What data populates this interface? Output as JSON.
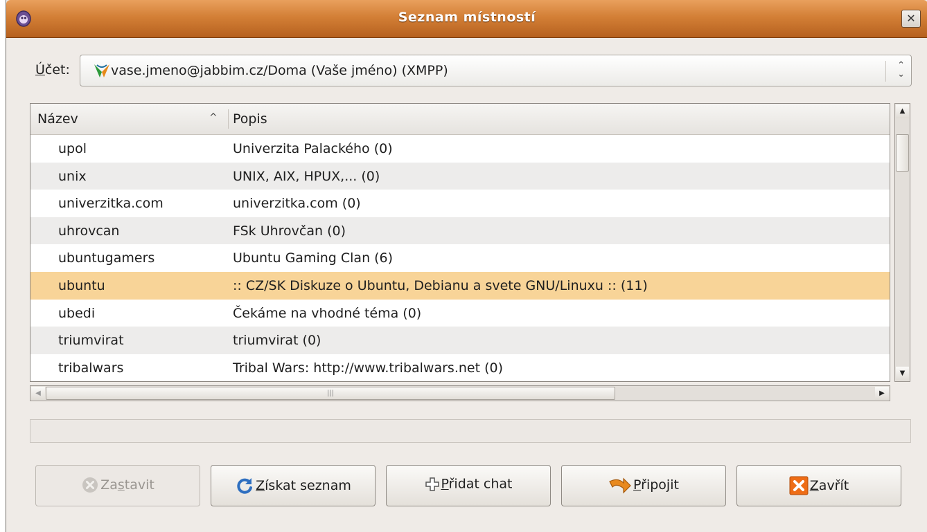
{
  "window": {
    "title": "Seznam místností",
    "close_glyph": "✕"
  },
  "account": {
    "label_accel": "Ú",
    "label_rest": "čet:",
    "value": "vase.jmeno@jabbim.cz/Doma (Vaše jméno) (XMPP)",
    "icon": "xmpp-icon"
  },
  "list": {
    "headers": {
      "name": "Název",
      "description": "Popis",
      "sort_indicator": "^"
    },
    "rows": [
      {
        "name": "upol",
        "description": "Univerzita Palackého (0)"
      },
      {
        "name": "unix",
        "description": "UNIX, AIX, HPUX,... (0)"
      },
      {
        "name": "univerzitka.com",
        "description": "univerzitka.com (0)"
      },
      {
        "name": "uhrovcan",
        "description": "FSk Uhrovčan (0)"
      },
      {
        "name": "ubuntugamers",
        "description": "Ubuntu Gaming Clan (6)"
      },
      {
        "name": "ubuntu",
        "description": ":: CZ/SK Diskuze o Ubuntu, Debianu a svete GNU/Linuxu :: (11)"
      },
      {
        "name": "ubedi",
        "description": "Čekáme na vhodné téma (0)"
      },
      {
        "name": "triumvirat",
        "description": "triumvirat (0)"
      },
      {
        "name": "tribalwars",
        "description": "Tribal Wars: http://www.tribalwars.net (0)"
      }
    ],
    "selected_row": "ubuntu"
  },
  "buttons": {
    "stop": {
      "pre": "Za",
      "accel": "s",
      "post": "tavit",
      "enabled": false,
      "icon": "stop-icon"
    },
    "get_list": {
      "pre": "",
      "accel": "Z",
      "post": "ískat seznam",
      "enabled": true,
      "icon": "refresh-icon"
    },
    "add_chat": {
      "pre": "",
      "accel": "P",
      "post": "řidat chat",
      "enabled": true,
      "icon": "add-icon"
    },
    "join": {
      "pre": "",
      "accel": "P",
      "post": "řipojit",
      "enabled": true,
      "icon": "join-arrow-icon"
    },
    "close": {
      "pre": "",
      "accel": "Z",
      "post": "avřít",
      "enabled": true,
      "icon": "close-icon"
    }
  },
  "colors": {
    "titlebar": "#d37f36",
    "selection": "#f8d498",
    "window_bg": "#efebe7"
  }
}
